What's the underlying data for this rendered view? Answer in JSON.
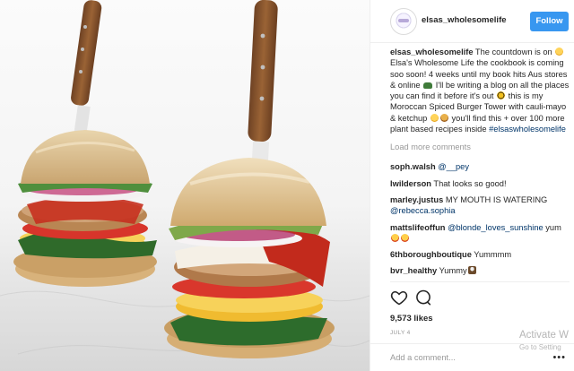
{
  "post": {
    "username": "elsas_wholesomelife",
    "follow_label": "Follow",
    "caption": {
      "author": "elsas_wholesomelife",
      "p1": " The countdown is on ",
      "p2": " Elsa's Wholesome Life the cookbook is coming soo soon! 4 weeks until my book hits Aus stores & online ",
      "p3": " I'll be writing a blog on all the places you can find it before it's out ",
      "p4": " this is my Moroccan Spiced Burger Tower with cauli-mayo & ketchup ",
      "p5": " you'll find this + over 100 more plant based recipes inside ",
      "hashtag": "#elsaswholesomelife"
    },
    "load_more": "Load more comments",
    "comments": [
      {
        "user": "soph.walsh",
        "pre": " ",
        "mention": "@__pey",
        "post": "",
        "emoji": ""
      },
      {
        "user": "lwilderson",
        "pre": " That looks so good!",
        "mention": "",
        "post": "",
        "emoji": ""
      },
      {
        "user": "marley.justus",
        "pre": " MY MOUTH IS WATERING ",
        "mention": "@rebecca.sophia",
        "post": "",
        "emoji": ""
      },
      {
        "user": "mattslifeoffun",
        "pre": " ",
        "mention": "@blonde_loves_sunshine",
        "post": " yum ",
        "emoji": "yum-emoji"
      },
      {
        "user": "6thboroughboutique",
        "pre": " Yummmm",
        "mention": "",
        "post": "",
        "emoji": ""
      },
      {
        "user": "bvr_healthy",
        "pre": " Yummy",
        "mention": "",
        "post": "",
        "emoji": "cook-emoji"
      }
    ],
    "likes": "9,573 likes",
    "date": "JULY 4",
    "add_comment_placeholder": "Add a comment...",
    "more_dots": "•••"
  },
  "watermark": {
    "line1": "Activate W",
    "line2": "Go to Setting"
  },
  "icons": [
    "heart-icon",
    "comment-icon",
    "more-options-icon"
  ],
  "colors": {
    "follow": "#3897f0",
    "link": "#003569",
    "muted": "#999999"
  }
}
